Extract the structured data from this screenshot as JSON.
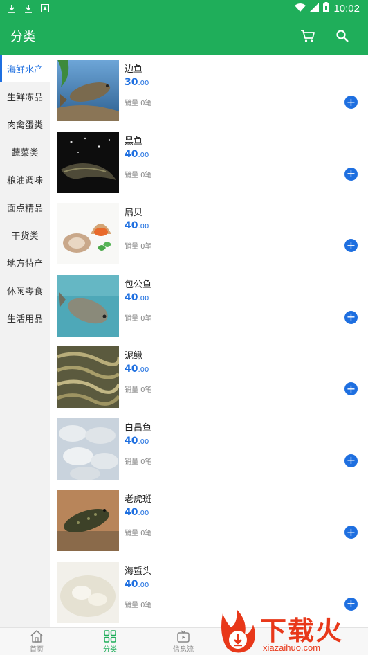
{
  "status_bar": {
    "time": "10:02",
    "icons": [
      "download-icon",
      "download-icon",
      "notification-icon",
      "wifi-icon",
      "signal-icon",
      "battery-icon"
    ]
  },
  "app_bar": {
    "title": "分类",
    "actions": [
      "cart-icon",
      "search-icon"
    ]
  },
  "sidebar": {
    "items": [
      {
        "label": "海鲜水产",
        "active": true
      },
      {
        "label": "生鲜冻品"
      },
      {
        "label": "肉禽蛋类"
      },
      {
        "label": "蔬菜类"
      },
      {
        "label": "粮油调味"
      },
      {
        "label": "面点精品"
      },
      {
        "label": "干货类"
      },
      {
        "label": "地方特产"
      },
      {
        "label": "休闲零食"
      },
      {
        "label": "生活用品"
      }
    ]
  },
  "products": [
    {
      "name": "边鱼",
      "price_int": "30",
      "price_dec": ".00",
      "sales": "销量 0笔"
    },
    {
      "name": "黑鱼",
      "price_int": "40",
      "price_dec": ".00",
      "sales": "销量 0笔"
    },
    {
      "name": "扇贝",
      "price_int": "40",
      "price_dec": ".00",
      "sales": "销量 0笔"
    },
    {
      "name": "包公鱼",
      "price_int": "40",
      "price_dec": ".00",
      "sales": "销量 0笔"
    },
    {
      "name": "泥鳅",
      "price_int": "40",
      "price_dec": ".00",
      "sales": "销量 0笔"
    },
    {
      "name": "白昌鱼",
      "price_int": "40",
      "price_dec": ".00",
      "sales": "销量 0笔"
    },
    {
      "name": "老虎斑",
      "price_int": "40",
      "price_dec": ".00",
      "sales": "销量 0笔"
    },
    {
      "name": "海蜇头",
      "price_int": "40",
      "price_dec": ".00",
      "sales": "销量 0笔"
    }
  ],
  "bottom_nav": {
    "tabs": [
      {
        "label": "首页",
        "icon": "home-icon"
      },
      {
        "label": "分类",
        "icon": "category-icon",
        "active": true
      },
      {
        "label": "信息流",
        "icon": "tv-icon"
      }
    ]
  },
  "watermark": {
    "text": "下载火",
    "url": "xiazaihuo.com"
  },
  "colors": {
    "brand_green": "#1fae5a",
    "accent_blue": "#1e6fe0",
    "watermark_red": "#e8381a"
  }
}
